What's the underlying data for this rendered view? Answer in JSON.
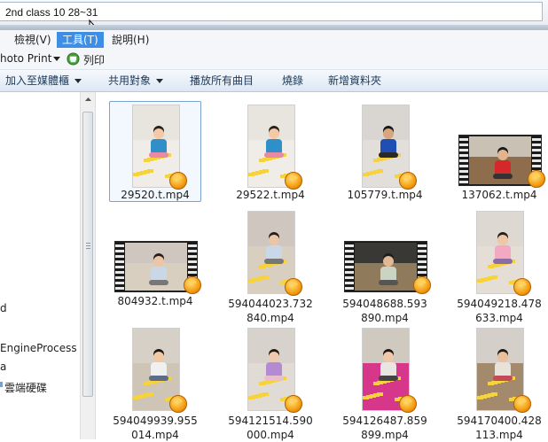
{
  "address": {
    "path": "2nd class 10 28~31"
  },
  "menu": [
    {
      "label": "檢視(V)",
      "active": false
    },
    {
      "label": "工具(T)",
      "active": true
    },
    {
      "label": "說明(H)",
      "active": false
    }
  ],
  "printbar": {
    "photo_print": "hoto Print",
    "print": "列印"
  },
  "commands": [
    {
      "label": "加入至媒體櫃",
      "caret": true
    },
    {
      "label": "共用對象",
      "caret": true
    },
    {
      "label": "播放所有曲目",
      "caret": false
    },
    {
      "label": "燒錄",
      "caret": false
    },
    {
      "label": "新增資料夾",
      "caret": false
    }
  ],
  "nav": {
    "item_d": "d",
    "item_engine": "EngineProcess",
    "item_a": "a",
    "item_cloud": "雲端硬碟"
  },
  "files": [
    {
      "name": "29520.t.mp4",
      "kind": "portrait",
      "scene": "girl-mat",
      "selected": true
    },
    {
      "name": "29522.t.mp4",
      "kind": "portrait",
      "scene": "girl-mat",
      "selected": false
    },
    {
      "name": "105779.t.mp4",
      "kind": "portrait",
      "scene": "boy-blue",
      "selected": false
    },
    {
      "name": "137062.t.mp4",
      "kind": "film",
      "scene": "boy-red",
      "selected": false
    },
    {
      "name": "804932.t.mp4",
      "kind": "film",
      "scene": "girl-floor",
      "selected": false
    },
    {
      "name": "594044023.732\n840.mp4",
      "kind": "portrait",
      "scene": "girl-floor",
      "selected": false
    },
    {
      "name": "594048688.593\n890.mp4",
      "kind": "film",
      "scene": "tv-room",
      "selected": false
    },
    {
      "name": "594049218.478\n633.mp4",
      "kind": "portrait",
      "scene": "girl-pink",
      "selected": false
    },
    {
      "name": "594049939.955\n014.mp4",
      "kind": "portrait",
      "scene": "closeup",
      "selected": false
    },
    {
      "name": "594121514.590\n000.mp4",
      "kind": "portrait",
      "scene": "girl-sit",
      "selected": false
    },
    {
      "name": "594126487.859\n899.mp4",
      "kind": "portrait",
      "scene": "pink-rug",
      "selected": false
    },
    {
      "name": "594170400.428\n113.mp4",
      "kind": "portrait",
      "scene": "fan-room",
      "selected": false
    }
  ],
  "colors": {
    "menu_active": "#3d8ee4",
    "selection_border": "#7da2ce",
    "paper_yellow": "#f6d23c"
  }
}
